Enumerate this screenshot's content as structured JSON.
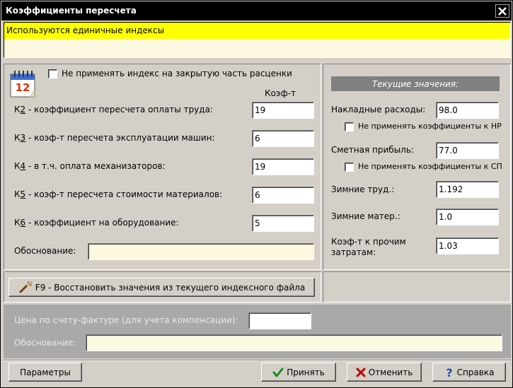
{
  "window": {
    "title": "Коэффициенты пересчета"
  },
  "info": {
    "text": "Используются единичные индексы"
  },
  "left": {
    "calendar_day": "12",
    "no_index_checkbox_label": "Не применять индекс на закрытую часть расценки",
    "coef_header": "Коэф-т",
    "rows": [
      {
        "key": "К2",
        "underline": "2",
        "text": " - коэффициент пересчета оплаты труда:",
        "value": "19"
      },
      {
        "key": "К3",
        "underline": "3",
        "text": " - коэф-т пересчета эксплуатации машин:",
        "value": "6"
      },
      {
        "key": "К4",
        "underline": "4",
        "text": " - в т.ч. оплата механизаторов:",
        "value": "19"
      },
      {
        "key": "К5",
        "underline": "5",
        "text": " - коэф-т пересчета стоимости материалов:",
        "value": "6"
      },
      {
        "key": "К6",
        "underline": "6",
        "text": " - коэффициент на оборудование:",
        "value": "5"
      }
    ],
    "justification_label": "Обоснование:",
    "justification_value": ""
  },
  "right": {
    "header": "Текущие значения:",
    "overhead_label": "Накладные расходы:",
    "overhead_value": "98.0",
    "overhead_check_label": "Не применять коэффициенты к НР",
    "profit_label": "Сметная прибыль:",
    "profit_value": "77.0",
    "profit_check_label": "Не применять коэффициенты к СП",
    "winter_labor_label": "Зимние труд.:",
    "winter_labor_value": "1.192",
    "winter_mat_label": "Зимние матер.:",
    "winter_mat_value": "1.0",
    "other_label_1": "Коэф-т к прочим",
    "other_label_2": "затратам:",
    "other_value": "1.03"
  },
  "restore_button": {
    "label": "F9 - Восстановить значения из текущего индексного файла"
  },
  "compensation": {
    "price_label": "Цена по счету-фактуре (для учета компенсации):",
    "price_value": "",
    "justification_label": "Обоснование:",
    "justification_value": ""
  },
  "footer": {
    "params_label": "Параметры",
    "accept_label": "Принять",
    "cancel_label": "Отменить",
    "help_label": "Справка"
  },
  "colors": {
    "info_bg": "#ffff00",
    "accept_icon": "#1a8a1a",
    "cancel_icon": "#c00000",
    "help_icon": "#1f4fb0"
  }
}
